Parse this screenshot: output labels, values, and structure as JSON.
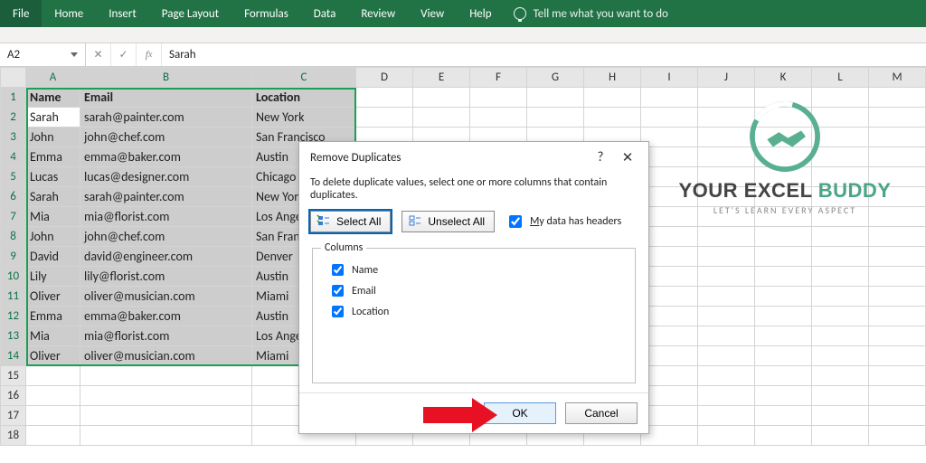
{
  "ribbon": {
    "tabs": [
      "File",
      "Home",
      "Insert",
      "Page Layout",
      "Formulas",
      "Data",
      "Review",
      "View",
      "Help"
    ],
    "search_placeholder": "Tell me what you want to do"
  },
  "namebox": {
    "ref": "A2"
  },
  "formula": {
    "value": "Sarah"
  },
  "columns": [
    "A",
    "B",
    "C",
    "D",
    "E",
    "F",
    "G",
    "H",
    "I",
    "J",
    "K",
    "L",
    "M"
  ],
  "headers": [
    "Name",
    "Email",
    "Location"
  ],
  "rows": [
    {
      "n": 1,
      "cells": [
        "Name",
        "Email",
        "Location"
      ],
      "is_header": true
    },
    {
      "n": 2,
      "cells": [
        "Sarah",
        "sarah@painter.com",
        "New York"
      ]
    },
    {
      "n": 3,
      "cells": [
        "John",
        "john@chef.com",
        "San Francisco"
      ]
    },
    {
      "n": 4,
      "cells": [
        "Emma",
        "emma@baker.com",
        "Austin"
      ]
    },
    {
      "n": 5,
      "cells": [
        "Lucas",
        "lucas@designer.com",
        "Chicago"
      ]
    },
    {
      "n": 6,
      "cells": [
        "Sarah",
        "sarah@painter.com",
        "New York"
      ]
    },
    {
      "n": 7,
      "cells": [
        "Mia",
        "mia@florist.com",
        "Los Angeles"
      ]
    },
    {
      "n": 8,
      "cells": [
        "John",
        "john@chef.com",
        "San Francisco"
      ]
    },
    {
      "n": 9,
      "cells": [
        "David",
        "david@engineer.com",
        "Denver"
      ]
    },
    {
      "n": 10,
      "cells": [
        "Lily",
        "lily@florist.com",
        "Austin"
      ]
    },
    {
      "n": 11,
      "cells": [
        "Oliver",
        "oliver@musician.com",
        "Miami"
      ]
    },
    {
      "n": 12,
      "cells": [
        "Emma",
        "emma@baker.com",
        "Austin"
      ]
    },
    {
      "n": 13,
      "cells": [
        "Mia",
        "mia@florist.com",
        "Los Angeles"
      ]
    },
    {
      "n": 14,
      "cells": [
        "Oliver",
        "oliver@musician.com",
        "Miami"
      ]
    },
    {
      "n": 15,
      "cells": [
        "",
        "",
        ""
      ]
    },
    {
      "n": 16,
      "cells": [
        "",
        "",
        ""
      ]
    },
    {
      "n": 17,
      "cells": [
        "",
        "",
        ""
      ]
    },
    {
      "n": 18,
      "cells": [
        "",
        "",
        ""
      ]
    }
  ],
  "dialog": {
    "title": "Remove Duplicates",
    "desc": "To delete duplicate values, select one or more columns that contain duplicates.",
    "select_all": "Select All",
    "unselect_all": "Unselect All",
    "headers_chk": "My data has headers",
    "columns_label": "Columns",
    "columns": [
      "Name",
      "Email",
      "Location"
    ],
    "ok": "OK",
    "cancel": "Cancel"
  },
  "brand": {
    "line1": "YOUR EXCEL ",
    "line1_green": "BUDDY",
    "tag": "LET'S LEARN EVERY ASPECT"
  }
}
